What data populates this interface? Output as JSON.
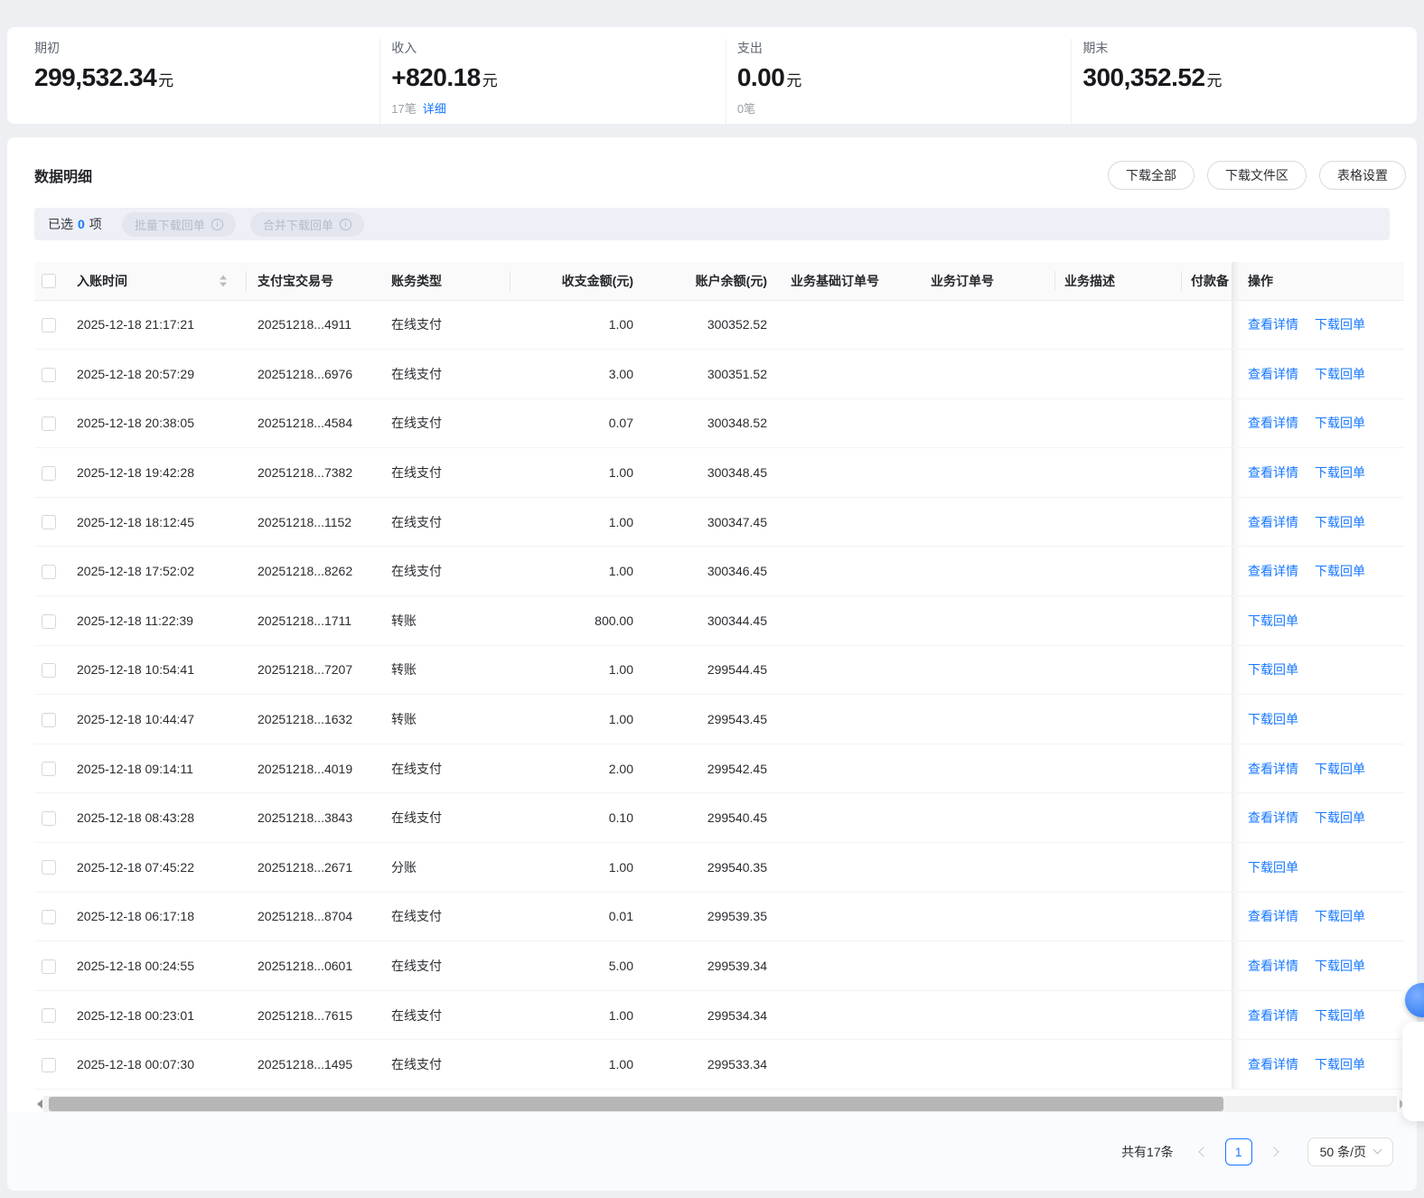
{
  "colors": {
    "accent": "#1677ff",
    "link_blue": "#1677ff"
  },
  "summary": {
    "cards": [
      {
        "label": "期初",
        "value": "299,532.34",
        "unit": "元",
        "sub_count": "",
        "sub_link": ""
      },
      {
        "label": "收入",
        "value": "+820.18",
        "unit": "元",
        "sub_count": "17笔",
        "sub_link": "详细"
      },
      {
        "label": "支出",
        "value": "0.00",
        "unit": "元",
        "sub_count": "0笔",
        "sub_link": ""
      },
      {
        "label": "期末",
        "value": "300,352.52",
        "unit": "元",
        "sub_count": "",
        "sub_link": ""
      }
    ]
  },
  "panel": {
    "title": "数据明细",
    "buttons": [
      "下载全部",
      "下载文件区",
      "表格设置"
    ],
    "selection": {
      "prefix": "已选",
      "count": "0",
      "suffix": "项",
      "batch_button": "批量下载回单",
      "merge_button": "合并下载回单"
    }
  },
  "table": {
    "columns": [
      "入账时间",
      "支付宝交易号",
      "账务类型",
      "收支金额(元)",
      "账户余额(元)",
      "业务基础订单号",
      "业务订单号",
      "业务描述",
      "付款备",
      "操作"
    ],
    "rows": [
      {
        "time": "2025-12-18 21:17:21",
        "txn": "20251218...4911",
        "type": "在线支付",
        "amount": "1.00",
        "balance": "300352.52",
        "actions": [
          "查看详情",
          "下载回单"
        ]
      },
      {
        "time": "2025-12-18 20:57:29",
        "txn": "20251218...6976",
        "type": "在线支付",
        "amount": "3.00",
        "balance": "300351.52",
        "actions": [
          "查看详情",
          "下载回单"
        ]
      },
      {
        "time": "2025-12-18 20:38:05",
        "txn": "20251218...4584",
        "type": "在线支付",
        "amount": "0.07",
        "balance": "300348.52",
        "actions": [
          "查看详情",
          "下载回单"
        ]
      },
      {
        "time": "2025-12-18 19:42:28",
        "txn": "20251218...7382",
        "type": "在线支付",
        "amount": "1.00",
        "balance": "300348.45",
        "actions": [
          "查看详情",
          "下载回单"
        ]
      },
      {
        "time": "2025-12-18 18:12:45",
        "txn": "20251218...1152",
        "type": "在线支付",
        "amount": "1.00",
        "balance": "300347.45",
        "actions": [
          "查看详情",
          "下载回单"
        ]
      },
      {
        "time": "2025-12-18 17:52:02",
        "txn": "20251218...8262",
        "type": "在线支付",
        "amount": "1.00",
        "balance": "300346.45",
        "actions": [
          "查看详情",
          "下载回单"
        ]
      },
      {
        "time": "2025-12-18 11:22:39",
        "txn": "20251218...1711",
        "type": "转账",
        "amount": "800.00",
        "balance": "300344.45",
        "actions": [
          "下载回单"
        ]
      },
      {
        "time": "2025-12-18 10:54:41",
        "txn": "20251218...7207",
        "type": "转账",
        "amount": "1.00",
        "balance": "299544.45",
        "actions": [
          "下载回单"
        ]
      },
      {
        "time": "2025-12-18 10:44:47",
        "txn": "20251218...1632",
        "type": "转账",
        "amount": "1.00",
        "balance": "299543.45",
        "actions": [
          "下载回单"
        ]
      },
      {
        "time": "2025-12-18 09:14:11",
        "txn": "20251218...4019",
        "type": "在线支付",
        "amount": "2.00",
        "balance": "299542.45",
        "actions": [
          "查看详情",
          "下载回单"
        ]
      },
      {
        "time": "2025-12-18 08:43:28",
        "txn": "20251218...3843",
        "type": "在线支付",
        "amount": "0.10",
        "balance": "299540.45",
        "actions": [
          "查看详情",
          "下载回单"
        ]
      },
      {
        "time": "2025-12-18 07:45:22",
        "txn": "20251218...2671",
        "type": "分账",
        "amount": "1.00",
        "balance": "299540.35",
        "actions": [
          "下载回单"
        ]
      },
      {
        "time": "2025-12-18 06:17:18",
        "txn": "20251218...8704",
        "type": "在线支付",
        "amount": "0.01",
        "balance": "299539.35",
        "actions": [
          "查看详情",
          "下载回单"
        ]
      },
      {
        "time": "2025-12-18 00:24:55",
        "txn": "20251218...0601",
        "type": "在线支付",
        "amount": "5.00",
        "balance": "299539.34",
        "actions": [
          "查看详情",
          "下载回单"
        ]
      },
      {
        "time": "2025-12-18 00:23:01",
        "txn": "20251218...7615",
        "type": "在线支付",
        "amount": "1.00",
        "balance": "299534.34",
        "actions": [
          "查看详情",
          "下载回单"
        ]
      },
      {
        "time": "2025-12-18 00:07:30",
        "txn": "20251218...1495",
        "type": "在线支付",
        "amount": "1.00",
        "balance": "299533.34",
        "actions": [
          "查看详情",
          "下载回单"
        ]
      }
    ]
  },
  "pagination": {
    "total": "共有17条",
    "page": "1",
    "page_size": "50 条/页"
  }
}
